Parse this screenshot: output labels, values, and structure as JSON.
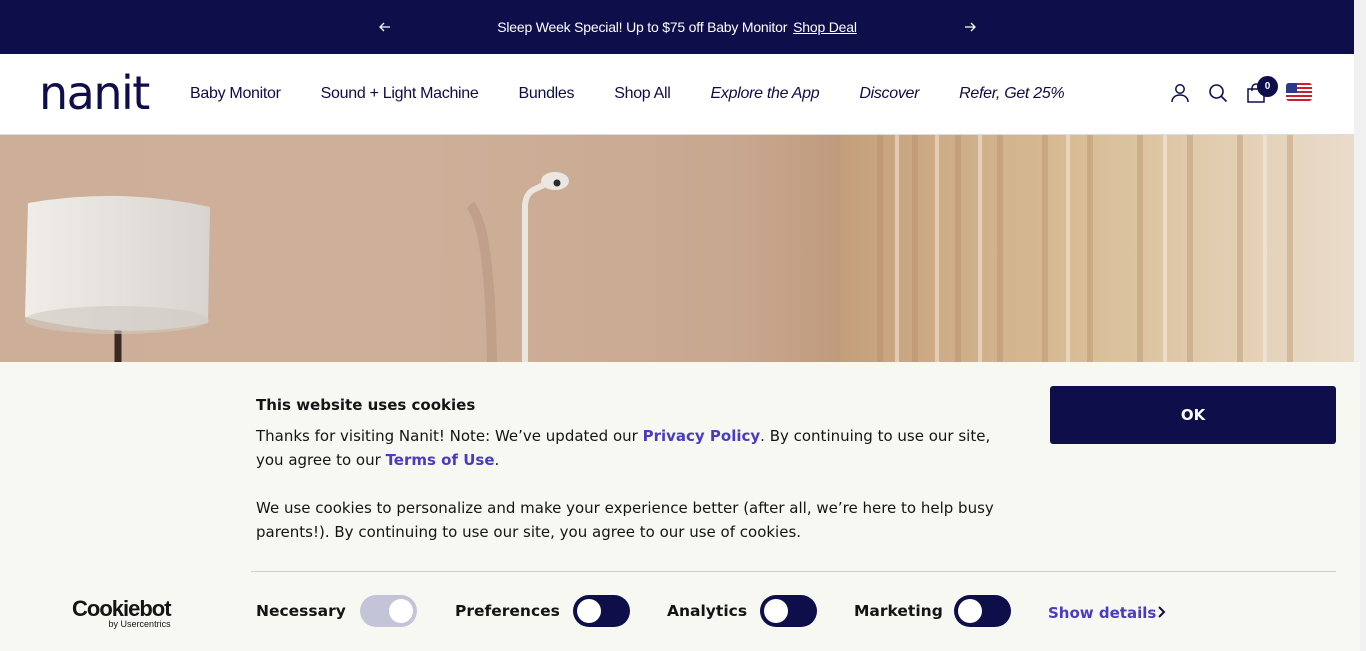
{
  "announcement": {
    "message": "Sleep Week Special! Up to $75 off Baby Monitor",
    "link_label": "Shop Deal",
    "prev_icon": "arrow-left-icon",
    "next_icon": "arrow-right-icon"
  },
  "header": {
    "logo_text": "nanit",
    "nav": [
      {
        "label": "Baby Monitor"
      },
      {
        "label": "Sound + Light Machine"
      },
      {
        "label": "Bundles"
      },
      {
        "label": "Shop All"
      },
      {
        "label": "Explore the App"
      },
      {
        "label": "Discover"
      },
      {
        "label": "Refer, Get 25%"
      }
    ],
    "icons": [
      "account-icon",
      "search-icon",
      "cart-icon",
      "us-flag-icon"
    ],
    "cart_count": "0"
  },
  "cookie_banner": {
    "title": "This website uses cookies",
    "text1_pre": "Thanks for visiting Nanit! Note: We’ve updated our ",
    "privacy_link": "Privacy Policy",
    "text1_mid": ". By continuing to use our site, you agree to our ",
    "terms_link": "Terms of Use",
    "text1_post": ".",
    "text2": "We use cookies to personalize and make your experience better (after all, we’re here to help busy parents!). By continuing to use our site, you agree to our use of cookies.",
    "ok_label": "OK",
    "brand_main": "Cookiebot",
    "brand_sub": "by Usercentrics",
    "toggles": [
      {
        "label": "Necessary",
        "state": "on-disabled"
      },
      {
        "label": "Preferences",
        "state": "off"
      },
      {
        "label": "Analytics",
        "state": "off"
      },
      {
        "label": "Marketing",
        "state": "off"
      }
    ],
    "show_details_label": "Show details"
  },
  "colors": {
    "brand_navy": "#0e0e4a",
    "link_purple": "#4a3cc0",
    "banner_bg": "#f8f8f3"
  }
}
